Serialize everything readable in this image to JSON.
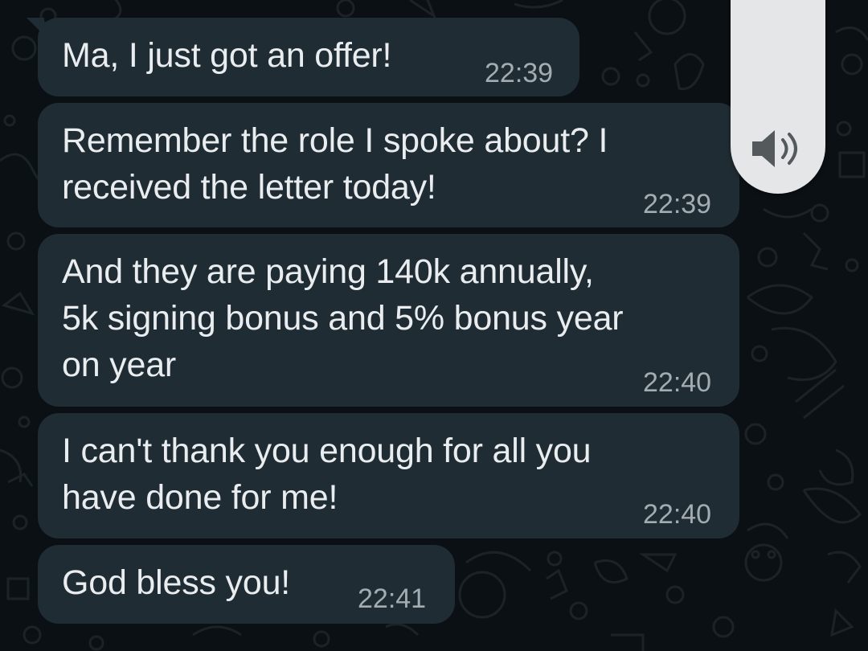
{
  "messages": [
    {
      "text": "Ma, I just got an offer!",
      "time": "22:39"
    },
    {
      "text": "Remember the role I spoke about? I\nreceived the letter today!",
      "time": "22:39"
    },
    {
      "text": "And they are paying 140k annually,\n5k signing bonus and 5% bonus year\non year",
      "time": "22:40"
    },
    {
      "text": "I can't thank you enough for all you\nhave done for me!",
      "time": "22:40"
    },
    {
      "text": "God bless you!",
      "time": "22:41"
    }
  ],
  "speaker_control": {
    "icon": "speaker-volume-icon"
  },
  "colors": {
    "background": "#0b1014",
    "bubble": "#202c33",
    "text": "#e9edef",
    "time": "#a3acb1",
    "speaker_panel": "#e4e6e7"
  }
}
